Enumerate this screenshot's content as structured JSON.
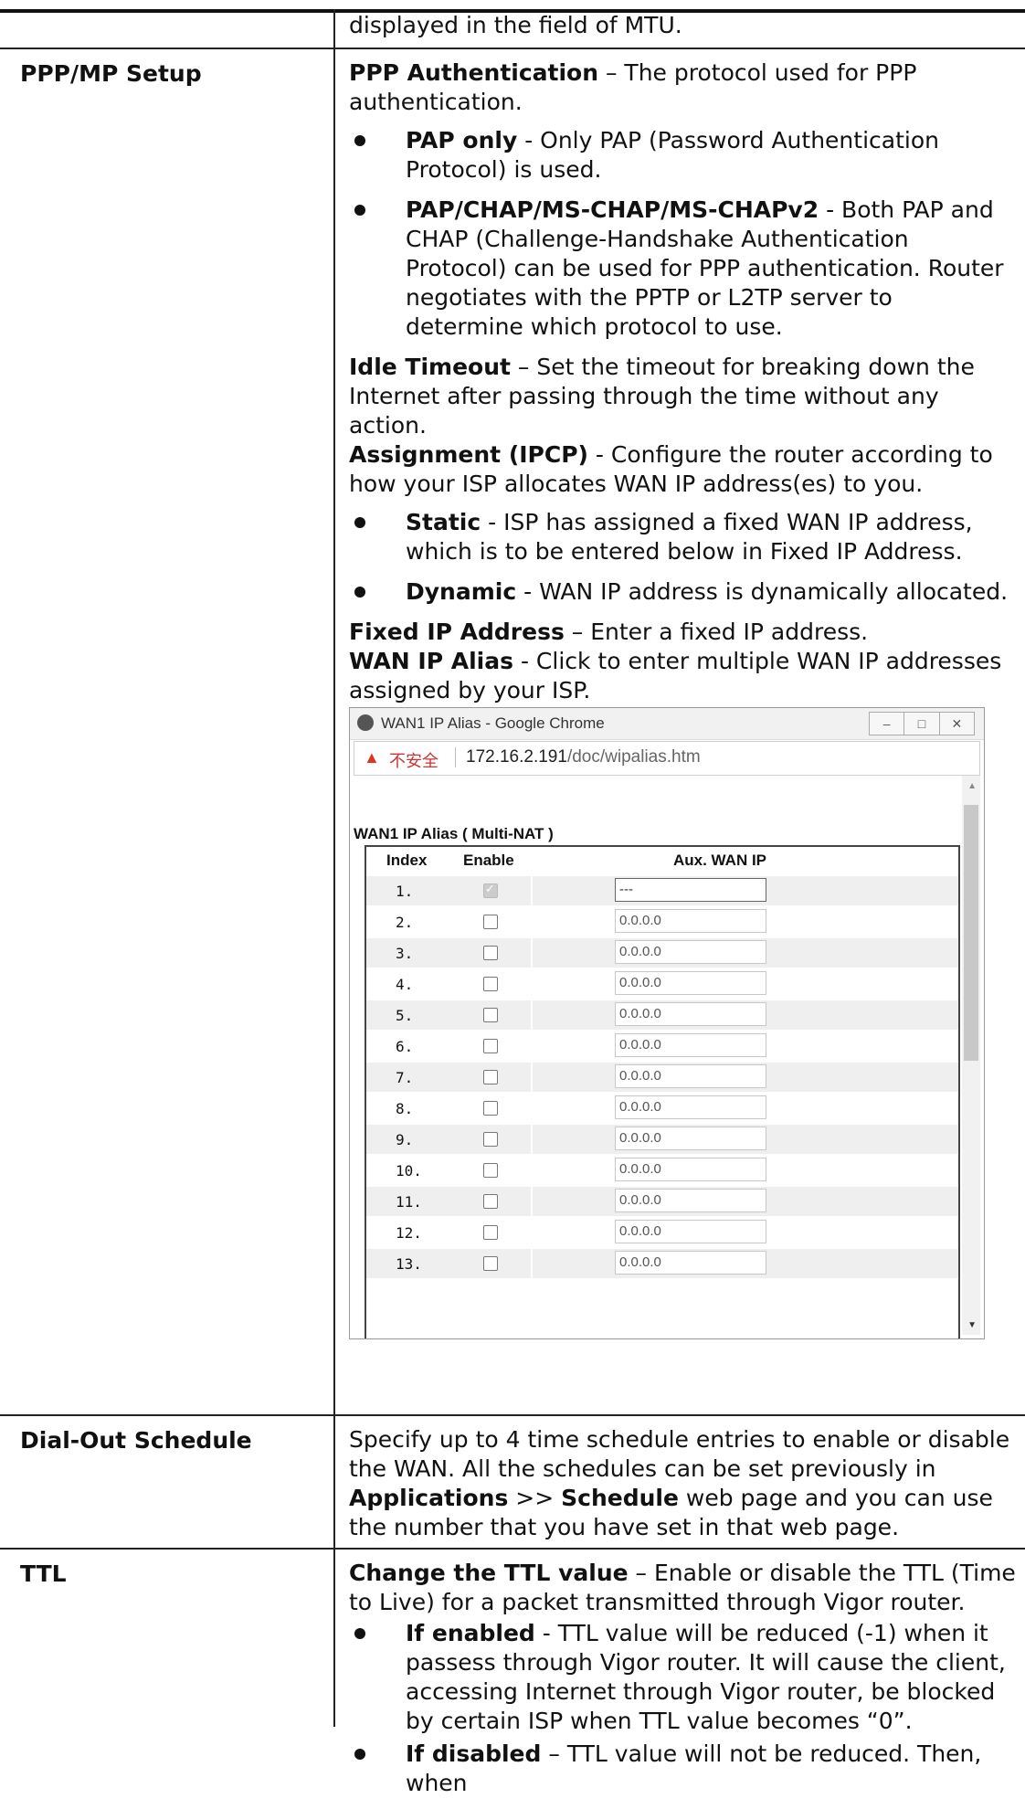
{
  "top_row": {
    "text": "displayed in the field of MTU."
  },
  "ppp": {
    "label": "PPP/MP Setup",
    "auth_bold": "PPP Authentication",
    "auth_text": " – The protocol used for PPP authentication.",
    "pap_bold": "PAP only",
    "pap_text": " - Only PAP (Password Authentication Protocol) is used.",
    "chap_bold": "PAP/CHAP/MS-CHAP/MS-CHAPv2",
    "chap_text": " - Both PAP and CHAP (Challenge-Handshake Authentication Protocol) can be used for PPP authentication. Router negotiates with the PPTP or L2TP server to determine which protocol to use.",
    "idle_bold": "Idle Timeout",
    "idle_text": " – Set the timeout for breaking down the Internet after passing through the time without any action.",
    "ipcp_bold": "Assignment (IPCP)",
    "ipcp_text": " - Configure the router according to how your ISP allocates WAN IP address(es) to you.",
    "static_bold": "Static",
    "static_text": " - ISP has assigned a fixed WAN IP address, which is to be entered below in Fixed IP Address.",
    "dynamic_bold": "Dynamic",
    "dynamic_text": " - WAN IP address is dynamically allocated.",
    "fixed_bold": "Fixed IP Address",
    "fixed_text": " – Enter a fixed IP address.",
    "alias_bold": "WAN IP Alias",
    "alias_text": " - Click to enter multiple WAN IP addresses assigned by your ISP."
  },
  "browser": {
    "window_title": "WAN1 IP Alias - Google Chrome",
    "insecure_label": "不安全",
    "url_host": "172.16.2.191",
    "url_path": "/doc/wipalias.htm",
    "btn_minimize": "–",
    "btn_maximize": "□",
    "btn_close": "✕"
  },
  "alias": {
    "title": "WAN1 IP Alias ( Multi-NAT )",
    "col_index": "Index",
    "col_enable": "Enable",
    "col_wan": "Aux. WAN IP",
    "rows": [
      {
        "index": "1.",
        "checked": true,
        "ip": "---"
      },
      {
        "index": "2.",
        "checked": false,
        "ip": "0.0.0.0"
      },
      {
        "index": "3.",
        "checked": false,
        "ip": "0.0.0.0"
      },
      {
        "index": "4.",
        "checked": false,
        "ip": "0.0.0.0"
      },
      {
        "index": "5.",
        "checked": false,
        "ip": "0.0.0.0"
      },
      {
        "index": "6.",
        "checked": false,
        "ip": "0.0.0.0"
      },
      {
        "index": "7.",
        "checked": false,
        "ip": "0.0.0.0"
      },
      {
        "index": "8.",
        "checked": false,
        "ip": "0.0.0.0"
      },
      {
        "index": "9.",
        "checked": false,
        "ip": "0.0.0.0"
      },
      {
        "index": "10.",
        "checked": false,
        "ip": "0.0.0.0"
      },
      {
        "index": "11.",
        "checked": false,
        "ip": "0.0.0.0"
      },
      {
        "index": "12.",
        "checked": false,
        "ip": "0.0.0.0"
      },
      {
        "index": "13.",
        "checked": false,
        "ip": "0.0.0.0"
      }
    ]
  },
  "dial": {
    "label": "Dial-Out Schedule",
    "text_a": "Specify up to 4 time schedule entries to enable or disable the WAN. All the schedules can be set previously in ",
    "bold_a": "Applications",
    "text_b": " >> ",
    "bold_b": "Schedule",
    "text_c": " web page and you can use the number that you have set in that web page."
  },
  "ttl": {
    "label": "TTL",
    "change_bold": "Change the TTL value",
    "change_text": " – Enable or disable the TTL (Time to Live) for a packet transmitted through Vigor router.",
    "enabled_bold": "If enabled",
    "enabled_text": " - TTL value will be reduced (-1) when it passess through Vigor router. It will cause the client, accessing Internet through Vigor router, be blocked by certain ISP when TTL value becomes “0”.",
    "disabled_bold": "If disabled",
    "disabled_text": " – TTL value will not be reduced. Then, when"
  }
}
